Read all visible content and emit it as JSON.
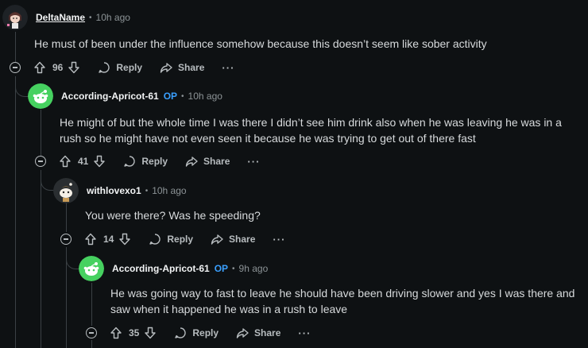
{
  "comments": [
    {
      "username": "DeltaName",
      "op": "",
      "time": "10h ago",
      "body": "He must of been under the influence somehow because this doesn’t seem like sober activity",
      "score": "96",
      "reply_label": "Reply",
      "share_label": "Share",
      "more_label": "···"
    },
    {
      "username": "According-Apricot-61",
      "op": "OP",
      "time": "10h ago",
      "body": "He might of but the whole time I was there I didn’t see him drink also when he was leaving he was in a rush so he might have not even seen it because he was trying to get out of there fast",
      "score": "41",
      "reply_label": "Reply",
      "share_label": "Share",
      "more_label": "···"
    },
    {
      "username": "withlovexo1",
      "op": "",
      "time": "10h ago",
      "body": "You were there? Was he speeding?",
      "score": "14",
      "reply_label": "Reply",
      "share_label": "Share",
      "more_label": "···"
    },
    {
      "username": "According-Apricot-61",
      "op": "OP",
      "time": "9h ago",
      "body": "He was going way to fast to leave he should have been driving slower and yes I was there and saw when it happened he was in a rush to leave",
      "score": "35",
      "reply_label": "Reply",
      "share_label": "Share",
      "more_label": "···"
    }
  ],
  "separator": "•",
  "colors": {
    "background": "#0e1113",
    "op_badge": "#3aa0ff",
    "snoo_green": "#46d160",
    "thread_line": "#3b4145"
  }
}
